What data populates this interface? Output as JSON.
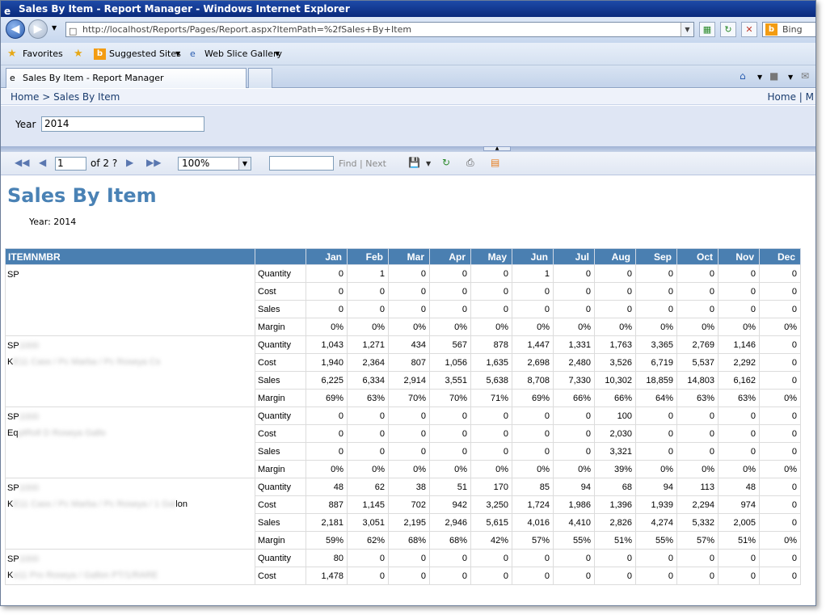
{
  "browser": {
    "title": "Sales By Item - Report Manager - Windows Internet Explorer",
    "url": "http://localhost/Reports/Pages/Report.aspx?ItemPath=%2fSales+By+Item",
    "search_label": "Bing",
    "favorites_label": "Favorites",
    "suggested_sites": "Suggested Sites",
    "web_slice": "Web Slice Gallery",
    "tab_label": "Sales By Item - Report Manager"
  },
  "breadcrumb": {
    "home": "Home",
    "sep": ">",
    "current": "Sales By Item",
    "right": "Home | M"
  },
  "params": {
    "year_label": "Year",
    "year_value": "2014"
  },
  "toolbar": {
    "page": "1",
    "of": "of 2 ?",
    "zoom": "100%",
    "find": "Find",
    "sep": "|",
    "next": "Next"
  },
  "report": {
    "title": "Sales By Item",
    "year_caption": "Year: 2014",
    "item_header": "ITEMNMBR",
    "months": [
      "Jan",
      "Feb",
      "Mar",
      "Apr",
      "May",
      "Jun",
      "Jul",
      "Aug",
      "Sep",
      "Oct",
      "Nov",
      "Dec"
    ],
    "items": [
      {
        "name1": "SP",
        "name1_blur": "",
        "name2": "",
        "name2_blur": "",
        "name2_tail": "",
        "rows": [
          {
            "metric": "Quantity",
            "values": [
              "0",
              "1",
              "0",
              "0",
              "0",
              "1",
              "0",
              "0",
              "0",
              "0",
              "0",
              "0"
            ]
          },
          {
            "metric": "Cost",
            "values": [
              "0",
              "0",
              "0",
              "0",
              "0",
              "0",
              "0",
              "0",
              "0",
              "0",
              "0",
              "0"
            ]
          },
          {
            "metric": "Sales",
            "values": [
              "0",
              "0",
              "0",
              "0",
              "0",
              "0",
              "0",
              "0",
              "0",
              "0",
              "0",
              "0"
            ]
          },
          {
            "metric": "Margin",
            "values": [
              "0%",
              "0%",
              "0%",
              "0%",
              "0%",
              "0%",
              "0%",
              "0%",
              "0%",
              "0%",
              "0%",
              "0%"
            ]
          }
        ]
      },
      {
        "name1": "SP",
        "name1_blur": "1000",
        "name2": "K",
        "name2_blur": "E11 Cass / Pc Marba / Pc Roseya Cs",
        "name2_tail": "",
        "rows": [
          {
            "metric": "Quantity",
            "values": [
              "1,043",
              "1,271",
              "434",
              "567",
              "878",
              "1,447",
              "1,331",
              "1,763",
              "3,365",
              "2,769",
              "1,146",
              "0"
            ]
          },
          {
            "metric": "Cost",
            "values": [
              "1,940",
              "2,364",
              "807",
              "1,056",
              "1,635",
              "2,698",
              "2,480",
              "3,526",
              "6,719",
              "5,537",
              "2,292",
              "0"
            ]
          },
          {
            "metric": "Sales",
            "values": [
              "6,225",
              "6,334",
              "2,914",
              "3,551",
              "5,638",
              "8,708",
              "7,330",
              "10,302",
              "18,859",
              "14,803",
              "6,162",
              "0"
            ]
          },
          {
            "metric": "Margin",
            "values": [
              "69%",
              "63%",
              "70%",
              "70%",
              "71%",
              "69%",
              "66%",
              "66%",
              "64%",
              "63%",
              "63%",
              "0%"
            ]
          }
        ]
      },
      {
        "name1": "SP",
        "name1_blur": "1000",
        "name2": "Eq",
        "name2_blur": "ptRoll D Roseya Gallo",
        "name2_tail": "",
        "rows": [
          {
            "metric": "Quantity",
            "values": [
              "0",
              "0",
              "0",
              "0",
              "0",
              "0",
              "0",
              "100",
              "0",
              "0",
              "0",
              "0"
            ]
          },
          {
            "metric": "Cost",
            "values": [
              "0",
              "0",
              "0",
              "0",
              "0",
              "0",
              "0",
              "2,030",
              "0",
              "0",
              "0",
              "0"
            ]
          },
          {
            "metric": "Sales",
            "values": [
              "0",
              "0",
              "0",
              "0",
              "0",
              "0",
              "0",
              "3,321",
              "0",
              "0",
              "0",
              "0"
            ]
          },
          {
            "metric": "Margin",
            "values": [
              "0%",
              "0%",
              "0%",
              "0%",
              "0%",
              "0%",
              "0%",
              "39%",
              "0%",
              "0%",
              "0%",
              "0%"
            ]
          }
        ]
      },
      {
        "name1": "SP",
        "name1_blur": "1000",
        "name2": "K",
        "name2_blur": "E11 Cass / Pc Marba / Pc Roseya / 1 Gal",
        "name2_tail": "lon",
        "rows": [
          {
            "metric": "Quantity",
            "values": [
              "48",
              "62",
              "38",
              "51",
              "170",
              "85",
              "94",
              "68",
              "94",
              "113",
              "48",
              "0"
            ]
          },
          {
            "metric": "Cost",
            "values": [
              "887",
              "1,145",
              "702",
              "942",
              "3,250",
              "1,724",
              "1,986",
              "1,396",
              "1,939",
              "2,294",
              "974",
              "0"
            ]
          },
          {
            "metric": "Sales",
            "values": [
              "2,181",
              "3,051",
              "2,195",
              "2,946",
              "5,615",
              "4,016",
              "4,410",
              "2,826",
              "4,274",
              "5,332",
              "2,005",
              "0"
            ]
          },
          {
            "metric": "Margin",
            "values": [
              "59%",
              "62%",
              "68%",
              "68%",
              "42%",
              "57%",
              "55%",
              "51%",
              "55%",
              "57%",
              "51%",
              "0%"
            ]
          }
        ]
      },
      {
        "name1": "SP",
        "name1_blur": "1000",
        "name2": "K",
        "name2_blur": "e11 Pro Roseya / Gallon PT/1/RARE",
        "name2_tail": "",
        "rows": [
          {
            "metric": "Quantity",
            "values": [
              "80",
              "0",
              "0",
              "0",
              "0",
              "0",
              "0",
              "0",
              "0",
              "0",
              "0",
              "0"
            ]
          },
          {
            "metric": "Cost",
            "values": [
              "1,478",
              "0",
              "0",
              "0",
              "0",
              "0",
              "0",
              "0",
              "0",
              "0",
              "0",
              "0"
            ]
          }
        ]
      }
    ]
  }
}
